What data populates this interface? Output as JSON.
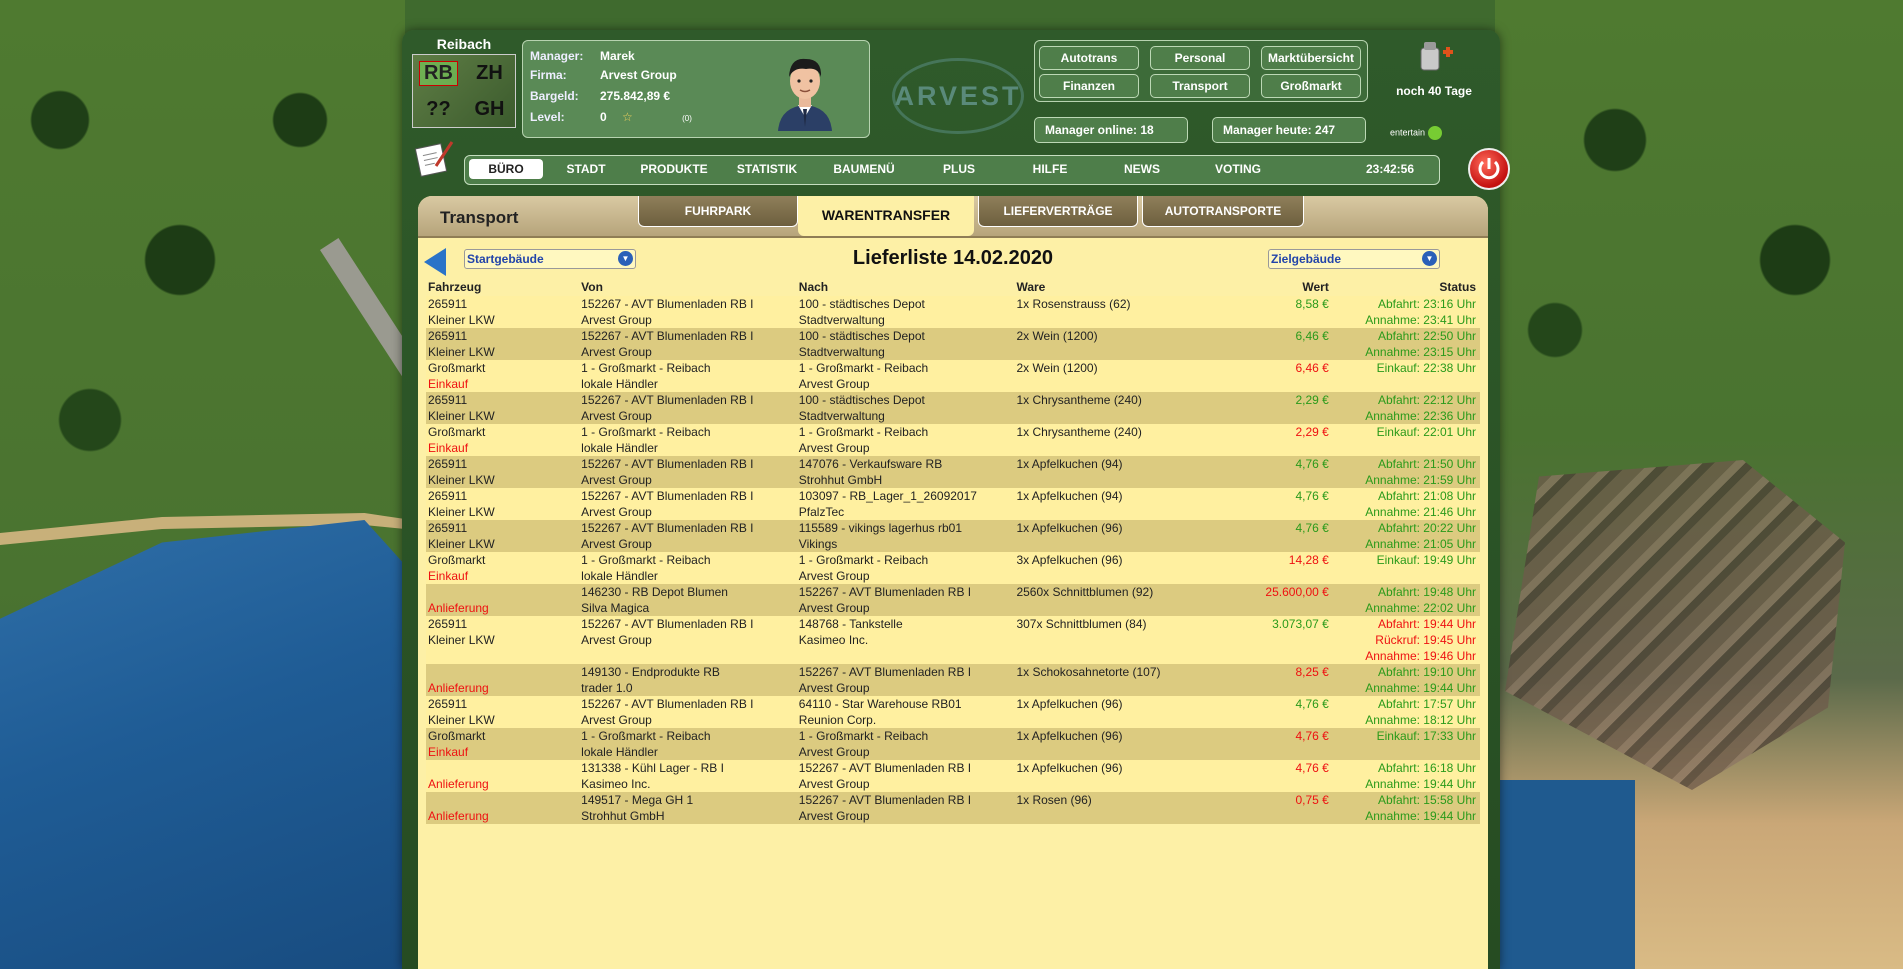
{
  "city": {
    "name": "Reibach",
    "codes": [
      "RB",
      "ZH",
      "??",
      "GH"
    ]
  },
  "manager": {
    "manager_label": "Manager:",
    "manager_value": "Marek",
    "firma_label": "Firma:",
    "firma_value": "Arvest Group",
    "bargeld_label": "Bargeld:",
    "bargeld_value": "275.842,89 €",
    "level_label": "Level:",
    "level_value": "0",
    "level_extra": "(0)"
  },
  "logo": "ARVEST",
  "quick_buttons": [
    "Autotrans",
    "Personal",
    "Marktübersicht",
    "Finanzen",
    "Transport",
    "Großmarkt"
  ],
  "stats": {
    "online": "Manager online: 18",
    "today": "Manager heute: 247"
  },
  "countdown": "noch 40 Tage",
  "entertain": "entertain",
  "nav": {
    "items": [
      "BÜRO",
      "STADT",
      "PRODUKTE",
      "STATISTIK",
      "BAUMENÜ",
      "PLUS",
      "HILFE",
      "NEWS",
      "VOTING"
    ],
    "time": "23:42:56"
  },
  "section": {
    "title": "Transport",
    "tabs": [
      "FUHRPARK",
      "WARENTRANSFER",
      "LIEFERVERTRÄGE",
      "AUTOTRANSPORTE"
    ]
  },
  "filters": {
    "start": "Startgebäude",
    "ziel": "Zielgebäude",
    "list_title": "Lieferliste 14.02.2020"
  },
  "columns": [
    "Fahrzeug",
    "Von",
    "Nach",
    "Ware",
    "Wert",
    "Status"
  ],
  "rows": [
    {
      "fz": [
        "265911",
        "Kleiner LKW"
      ],
      "von": [
        "152267 - AVT Blumenladen RB I",
        "Arvest Group"
      ],
      "nach": [
        "100 - städtisches Depot",
        "Stadtverwaltung"
      ],
      "ware": "1x Rosenstrauss (62)",
      "wert": "8,58 €",
      "wert_color": "green",
      "status": [
        "Abfahrt: 23:16 Uhr",
        "Annahme: 23:41 Uhr"
      ],
      "status_colors": [
        "green",
        "green"
      ]
    },
    {
      "fz": [
        "265911",
        "Kleiner LKW"
      ],
      "von": [
        "152267 - AVT Blumenladen RB I",
        "Arvest Group"
      ],
      "nach": [
        "100 - städtisches Depot",
        "Stadtverwaltung"
      ],
      "ware": "2x Wein (1200)",
      "wert": "6,46 €",
      "wert_color": "green",
      "status": [
        "Abfahrt: 22:50 Uhr",
        "Annahme: 23:15 Uhr"
      ],
      "status_colors": [
        "green",
        "green"
      ]
    },
    {
      "fz": [
        "Großmarkt",
        "Einkauf"
      ],
      "fz_red": true,
      "von": [
        "1 - Großmarkt - Reibach",
        "lokale Händler"
      ],
      "nach": [
        "1 - Großmarkt - Reibach",
        "Arvest Group"
      ],
      "ware": "2x Wein (1200)",
      "wert": "6,46 €",
      "wert_color": "red",
      "status": [
        "Einkauf: 22:38 Uhr",
        ""
      ],
      "status_colors": [
        "green",
        "green"
      ]
    },
    {
      "fz": [
        "265911",
        "Kleiner LKW"
      ],
      "von": [
        "152267 - AVT Blumenladen RB I",
        "Arvest Group"
      ],
      "nach": [
        "100 - städtisches Depot",
        "Stadtverwaltung"
      ],
      "ware": "1x Chrysantheme (240)",
      "wert": "2,29 €",
      "wert_color": "green",
      "status": [
        "Abfahrt: 22:12 Uhr",
        "Annahme: 22:36 Uhr"
      ],
      "status_colors": [
        "green",
        "green"
      ]
    },
    {
      "fz": [
        "Großmarkt",
        "Einkauf"
      ],
      "fz_red": true,
      "von": [
        "1 - Großmarkt - Reibach",
        "lokale Händler"
      ],
      "nach": [
        "1 - Großmarkt - Reibach",
        "Arvest Group"
      ],
      "ware": "1x Chrysantheme (240)",
      "wert": "2,29 €",
      "wert_color": "red",
      "status": [
        "Einkauf: 22:01 Uhr",
        ""
      ],
      "status_colors": [
        "green",
        "green"
      ]
    },
    {
      "fz": [
        "265911",
        "Kleiner LKW"
      ],
      "von": [
        "152267 - AVT Blumenladen RB I",
        "Arvest Group"
      ],
      "nach": [
        "147076 - Verkaufsware RB",
        "Strohhut GmbH"
      ],
      "ware": "1x Apfelkuchen (94)",
      "wert": "4,76 €",
      "wert_color": "green",
      "status": [
        "Abfahrt: 21:50 Uhr",
        "Annahme: 21:59 Uhr"
      ],
      "status_colors": [
        "green",
        "green"
      ]
    },
    {
      "fz": [
        "265911",
        "Kleiner LKW"
      ],
      "von": [
        "152267 - AVT Blumenladen RB I",
        "Arvest Group"
      ],
      "nach": [
        "103097 - RB_Lager_1_26092017",
        "PfalzTec"
      ],
      "ware": "1x Apfelkuchen (94)",
      "wert": "4,76 €",
      "wert_color": "green",
      "status": [
        "Abfahrt: 21:08 Uhr",
        "Annahme: 21:46 Uhr"
      ],
      "status_colors": [
        "green",
        "green"
      ]
    },
    {
      "fz": [
        "265911",
        "Kleiner LKW"
      ],
      "von": [
        "152267 - AVT Blumenladen RB I",
        "Arvest Group"
      ],
      "nach": [
        "115589 - vikings lagerhus rb01",
        "Vikings"
      ],
      "ware": "1x Apfelkuchen (96)",
      "wert": "4,76 €",
      "wert_color": "green",
      "status": [
        "Abfahrt: 20:22 Uhr",
        "Annahme: 21:05 Uhr"
      ],
      "status_colors": [
        "green",
        "green"
      ]
    },
    {
      "fz": [
        "Großmarkt",
        "Einkauf"
      ],
      "fz_red": true,
      "von": [
        "1 - Großmarkt - Reibach",
        "lokale Händler"
      ],
      "nach": [
        "1 - Großmarkt - Reibach",
        "Arvest Group"
      ],
      "ware": "3x Apfelkuchen (96)",
      "wert": "14,28 €",
      "wert_color": "red",
      "status": [
        "Einkauf: 19:49 Uhr",
        ""
      ],
      "status_colors": [
        "green",
        "green"
      ]
    },
    {
      "fz": [
        "",
        "Anlieferung"
      ],
      "fz_red": true,
      "von": [
        "146230 - RB Depot Blumen",
        "Silva Magica"
      ],
      "nach": [
        "152267 - AVT Blumenladen RB I",
        "Arvest Group"
      ],
      "ware": "2560x Schnittblumen (92)",
      "wert": "25.600,00 €",
      "wert_color": "red",
      "status": [
        "Abfahrt: 19:48 Uhr",
        "Annahme: 22:02 Uhr"
      ],
      "status_colors": [
        "green",
        "green"
      ]
    },
    {
      "fz": [
        "265911",
        "Kleiner LKW",
        ""
      ],
      "von": [
        "152267 - AVT Blumenladen RB I",
        "Arvest Group",
        ""
      ],
      "nach": [
        "148768 - Tankstelle",
        "Kasimeo Inc.",
        ""
      ],
      "ware": "307x Schnittblumen (84)",
      "wert": "3.073,07 €",
      "wert_color": "green",
      "status": [
        "Abfahrt: 19:44 Uhr",
        "Rückruf: 19:45 Uhr",
        "Annahme: 19:46 Uhr"
      ],
      "status_colors": [
        "red",
        "red",
        "red"
      ]
    },
    {
      "fz": [
        "",
        "Anlieferung"
      ],
      "fz_red": true,
      "von": [
        "149130 - Endprodukte RB",
        "trader 1.0"
      ],
      "nach": [
        "152267 - AVT Blumenladen RB I",
        "Arvest Group"
      ],
      "ware": "1x Schokosahnetorte (107)",
      "wert": "8,25 €",
      "wert_color": "red",
      "status": [
        "Abfahrt: 19:10 Uhr",
        "Annahme: 19:44 Uhr"
      ],
      "status_colors": [
        "green",
        "green"
      ]
    },
    {
      "fz": [
        "265911",
        "Kleiner LKW"
      ],
      "von": [
        "152267 - AVT Blumenladen RB I",
        "Arvest Group"
      ],
      "nach": [
        "64110 - Star Warehouse RB01",
        "Reunion Corp."
      ],
      "ware": "1x Apfelkuchen (96)",
      "wert": "4,76 €",
      "wert_color": "green",
      "status": [
        "Abfahrt: 17:57 Uhr",
        "Annahme: 18:12 Uhr"
      ],
      "status_colors": [
        "green",
        "green"
      ]
    },
    {
      "fz": [
        "Großmarkt",
        "Einkauf"
      ],
      "fz_red": true,
      "von": [
        "1 - Großmarkt - Reibach",
        "lokale Händler"
      ],
      "nach": [
        "1 - Großmarkt - Reibach",
        "Arvest Group"
      ],
      "ware": "1x Apfelkuchen (96)",
      "wert": "4,76 €",
      "wert_color": "red",
      "status": [
        "Einkauf: 17:33 Uhr",
        ""
      ],
      "status_colors": [
        "green",
        "green"
      ]
    },
    {
      "fz": [
        "",
        "Anlieferung"
      ],
      "fz_red": true,
      "von": [
        "131338 - Kühl Lager - RB I",
        "Kasimeo Inc."
      ],
      "nach": [
        "152267 - AVT Blumenladen RB I",
        "Arvest Group"
      ],
      "ware": "1x Apfelkuchen (96)",
      "wert": "4,76 €",
      "wert_color": "red",
      "status": [
        "Abfahrt: 16:18 Uhr",
        "Annahme: 19:44 Uhr"
      ],
      "status_colors": [
        "green",
        "green"
      ]
    },
    {
      "fz": [
        "",
        "Anlieferung"
      ],
      "fz_red": true,
      "von": [
        "149517 - Mega GH 1",
        "Strohhut GmbH"
      ],
      "nach": [
        "152267 - AVT Blumenladen RB I",
        "Arvest Group"
      ],
      "ware": "1x Rosen (96)",
      "wert": "0,75 €",
      "wert_color": "red",
      "status": [
        "Abfahrt: 15:58 Uhr",
        "Annahme: 19:44 Uhr"
      ],
      "status_colors": [
        "green",
        "green"
      ]
    }
  ]
}
